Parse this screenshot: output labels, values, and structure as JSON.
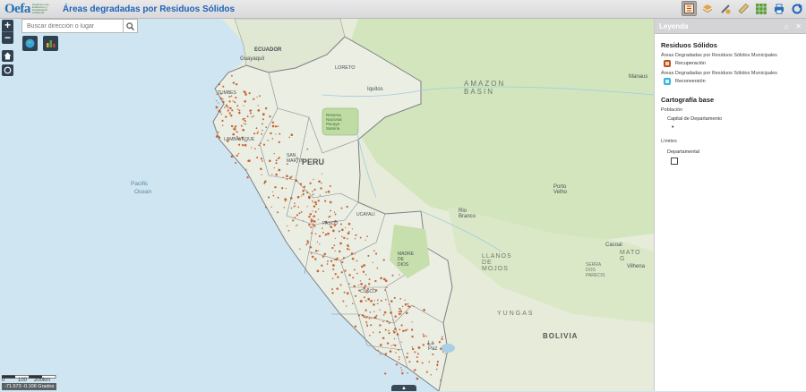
{
  "app": {
    "logo_text": "Oefa",
    "logo_tagline": "Organismo de Evaluación y Fiscalización Ambiental",
    "title": "Áreas degradadas por Residuos Sólidos"
  },
  "toolbar": {
    "tools": [
      "legend-icon",
      "layers-icon",
      "draw-icon",
      "measure-icon",
      "basemap-gallery-icon",
      "print-icon",
      "refresh-icon"
    ]
  },
  "search": {
    "placeholder": "Buscar dirección o lugar"
  },
  "map_labels": {
    "ecuador": "ECUADOR",
    "guayaquil": "Guayaquil",
    "loreto": "LORETO",
    "iquitos": "Iquitos",
    "pacaya": "Reserva Nacional Pacaya Samiria",
    "amazon": "AMAZON BASIN",
    "manaus": "Manaus",
    "tumbes": "TUMBES",
    "lambayeque": "LAMBAYEQUE",
    "san_martin": "SAN MARTIN",
    "peru": "PERU",
    "pacific": "Pacific",
    "ocean": "Ocean",
    "ucayali": "UCAYALI",
    "pasco": "PASCO",
    "cusco": "CUSCO",
    "madre_de_dios": "MADRE DE DIOS",
    "porto_velho": "Porto Velho",
    "rio_branco": "Rio Branco",
    "mato_grosso": "MATO G",
    "llanos": "LLANOS DE MOJOS",
    "yungas": "YUNGAS",
    "bolivia": "BOLIVIA",
    "la_paz": "La Paz",
    "serra": "SERRA DOS PARECIS",
    "cacoal": "Cacoal",
    "vilhena": "Vilhena"
  },
  "status": {
    "scale_labels": [
      "0",
      "100",
      "200km"
    ],
    "coordinates": "-71.573 -0.106 Grados"
  },
  "legend": {
    "title": "Leyenda",
    "sections": [
      {
        "title": "Residuos Sólidos",
        "layers": [
          {
            "name": "Áreas Degradadas por Residuos Sólidos Municipales",
            "item": "Recuperación",
            "color": "#c0501b"
          },
          {
            "name": "Áreas Degradadas por Residuos Sólidos Municipales",
            "item": "Reconversión",
            "color": "#35b4e6"
          }
        ]
      },
      {
        "title": "Cartografía base",
        "layers": [
          {
            "name": "Población",
            "item": "Capital de Departamento",
            "symbol": "•"
          },
          {
            "name": "Límites",
            "item": "Departamental"
          }
        ]
      }
    ]
  },
  "colors": {
    "accent": "#1d63b7",
    "recuperacion": "#c0501b",
    "reconversion": "#35b4e6",
    "ocean": "#cfe6f2",
    "land": "#e6ecd9",
    "forest": "#cfe3b8"
  }
}
